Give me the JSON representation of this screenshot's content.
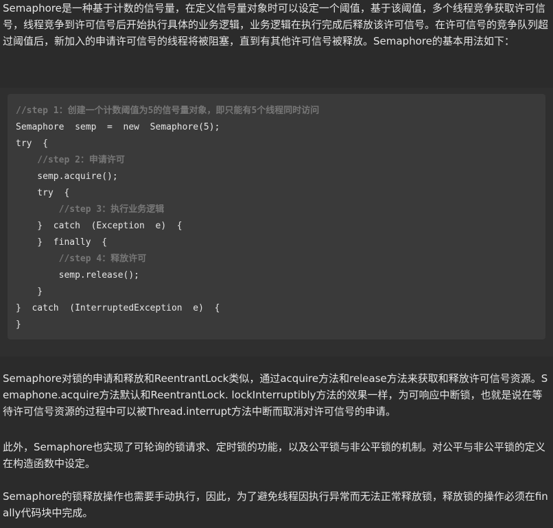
{
  "intro_paragraph": "Semaphore是一种基于计数的信号量，在定义信号量对象时可以设定一个阈值，基于该阈值，多个线程竞争获取许可信号，线程竞争到许可信号后开始执行具体的业务逻辑，业务逻辑在执行完成后释放该许可信号。在许可信号的竞争队列超过阈值后，新加入的申请许可信号的线程将被阻塞，直到有其他许可信号被释放。Semaphore的基本用法如下：",
  "code": {
    "lines": [
      {
        "text": "//step 1：创建一个计数阈值为5的信号量对象，即只能有5个线程同时访问",
        "is_comment": true
      },
      {
        "text": "Semaphore  semp  =  new  Semaphore(5);",
        "is_comment": false
      },
      {
        "text": "try  {",
        "is_comment": false
      },
      {
        "text": "    //step 2：申请许可",
        "is_comment": true
      },
      {
        "text": "    semp.acquire();",
        "is_comment": false
      },
      {
        "text": "    try  {",
        "is_comment": false
      },
      {
        "text": "        //step 3：执行业务逻辑",
        "is_comment": true
      },
      {
        "text": "    }  catch  (Exception  e)  {",
        "is_comment": false
      },
      {
        "text": "    }  finally  {",
        "is_comment": false
      },
      {
        "text": "        //step 4：释放许可",
        "is_comment": true
      },
      {
        "text": "        semp.release();",
        "is_comment": false
      },
      {
        "text": "    }",
        "is_comment": false
      },
      {
        "text": "}  catch  (InterruptedException  e)  {",
        "is_comment": false
      },
      {
        "text": "}",
        "is_comment": false
      }
    ]
  },
  "paragraph_2": "Semaphore对锁的申请和释放和ReentrantLock类似，通过acquire方法和release方法来获取和释放许可信号资源。Semaphone.acquire方法默认和ReentrantLock. lockInterruptibly方法的效果一样，为可响应中断锁，也就是说在等待许可信号资源的过程中可以被Thread.interrupt方法中断而取消对许可信号的申请。",
  "paragraph_3": "此外，Semaphore也实现了可轮询的锁请求、定时锁的功能，以及公平锁与非公平锁的机制。对公平与非公平锁的定义在构造函数中设定。",
  "paragraph_4": "Semaphore的锁释放操作也需要手动执行，因此，为了避免线程因执行异常而无法正常释放锁，释放锁的操作必须在finally代码块中完成。"
}
